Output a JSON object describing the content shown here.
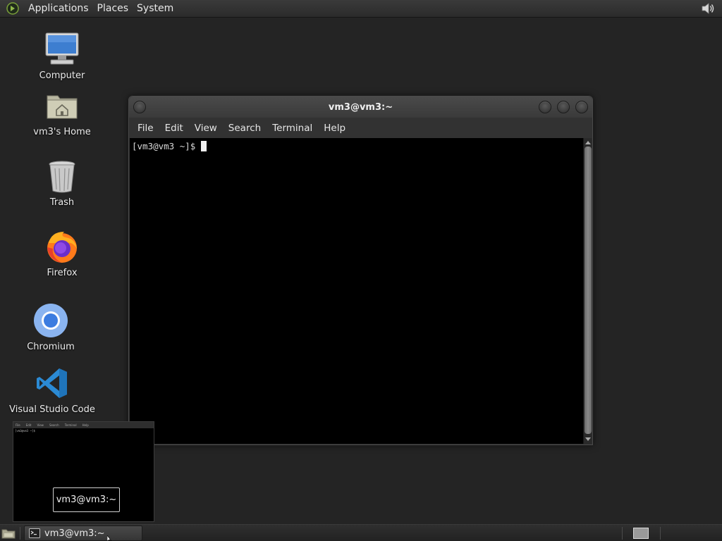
{
  "top_panel": {
    "menus": [
      {
        "label": "Applications"
      },
      {
        "label": "Places"
      },
      {
        "label": "System"
      }
    ]
  },
  "desktop": {
    "icons": [
      {
        "label": "Computer",
        "icon": "computer-icon"
      },
      {
        "label": "vm3's Home",
        "icon": "home-folder-icon"
      },
      {
        "label": "Trash",
        "icon": "trash-icon"
      },
      {
        "label": "Firefox",
        "icon": "firefox-icon"
      },
      {
        "label": "Chromium",
        "icon": "chromium-icon"
      },
      {
        "label": "Visual Studio Code",
        "icon": "vscode-icon"
      }
    ]
  },
  "terminal": {
    "title": "vm3@vm3:~",
    "menus": [
      {
        "label": "File"
      },
      {
        "label": "Edit"
      },
      {
        "label": "View"
      },
      {
        "label": "Search"
      },
      {
        "label": "Terminal"
      },
      {
        "label": "Help"
      }
    ],
    "prompt": "[vm3@vm3 ~]$"
  },
  "preview": {
    "caption": "vm3@vm3:~",
    "menus": [
      "File",
      "Edit",
      "View",
      "Search",
      "Terminal",
      "Help"
    ]
  },
  "taskbar": {
    "task_label": "vm3@vm3:~"
  },
  "colors": {
    "desktop_bg": "#242424",
    "terminal_bg": "#000000",
    "panel_bg": "#2b2b2b",
    "vscode_blue": "#2b8ad4",
    "chromium_blue": "#3b7ce0"
  }
}
